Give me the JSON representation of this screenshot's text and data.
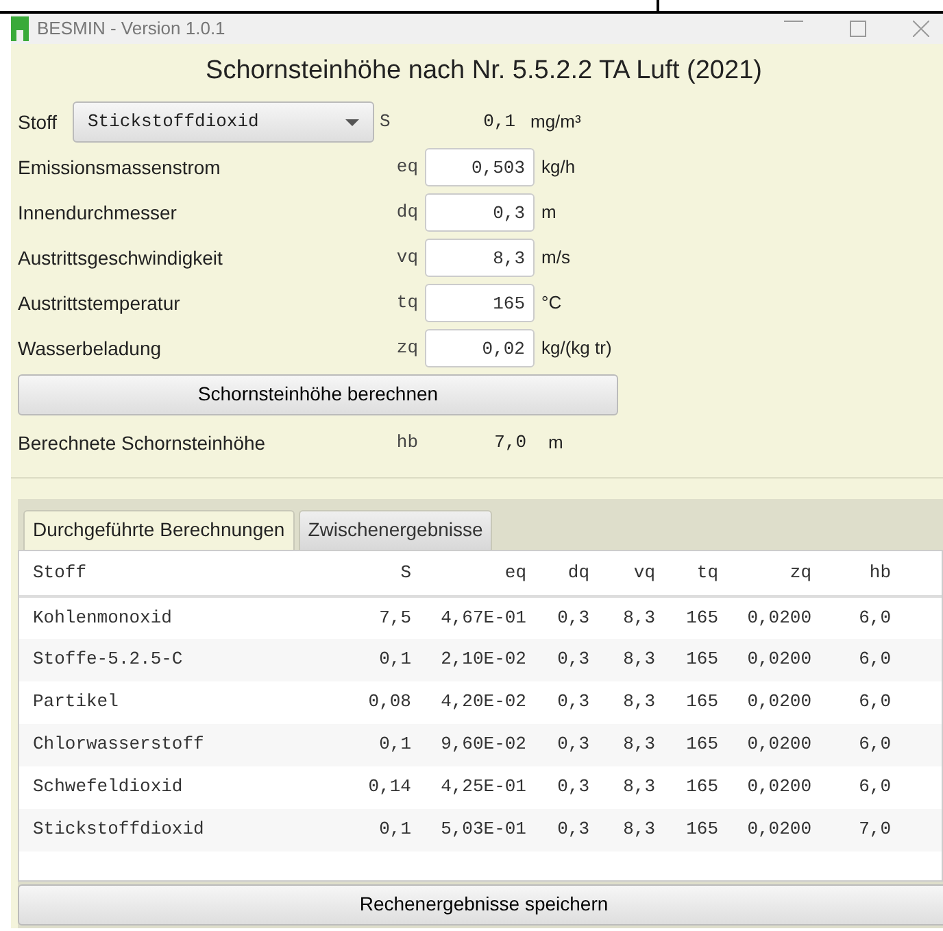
{
  "window": {
    "title": "BESMIN - Version 1.0.1"
  },
  "heading": "Schornsteinhöhe nach Nr. 5.5.2.2 TA Luft (2021)",
  "fields": [
    {
      "kind": "select",
      "label": "Stoff",
      "value": "Stickstoffdioxid",
      "symbol": "S",
      "reading": "0,1",
      "unit": "mg/m³"
    },
    {
      "kind": "input",
      "label": "Emissionsmassenstrom",
      "symbol": "eq",
      "value": "0,503",
      "unit": "kg/h"
    },
    {
      "kind": "input",
      "label": "Innendurchmesser",
      "symbol": "dq",
      "value": "0,3",
      "unit": "m"
    },
    {
      "kind": "input",
      "label": "Austrittsgeschwindigkeit",
      "symbol": "vq",
      "value": "8,3",
      "unit": "m/s"
    },
    {
      "kind": "input",
      "label": "Austrittstemperatur",
      "symbol": "tq",
      "value": "165",
      "unit": "°C"
    },
    {
      "kind": "input",
      "label": "Wasserbeladung",
      "symbol": "zq",
      "value": "0,02",
      "unit": "kg/(kg tr)"
    }
  ],
  "calculate_button": "Schornsteinhöhe berechnen",
  "result": {
    "label": "Berechnete Schornsteinhöhe",
    "symbol": "hb",
    "value": "7,0",
    "unit": "m"
  },
  "tabs": [
    {
      "label": "Durchgeführte Berechnungen",
      "selected": true
    },
    {
      "label": "Zwischenergebnisse",
      "selected": false
    }
  ],
  "table": {
    "columns": [
      "Stoff",
      "S",
      "eq",
      "dq",
      "vq",
      "tq",
      "zq",
      "hb"
    ],
    "rows": [
      [
        "Kohlenmonoxid",
        "7,5",
        "4,67E-01",
        "0,3",
        "8,3",
        "165",
        "0,0200",
        "6,0"
      ],
      [
        "Stoffe-5.2.5-C",
        "0,1",
        "2,10E-02",
        "0,3",
        "8,3",
        "165",
        "0,0200",
        "6,0"
      ],
      [
        "Partikel",
        "0,08",
        "4,20E-02",
        "0,3",
        "8,3",
        "165",
        "0,0200",
        "6,0"
      ],
      [
        "Chlorwasserstoff",
        "0,1",
        "9,60E-02",
        "0,3",
        "8,3",
        "165",
        "0,0200",
        "6,0"
      ],
      [
        "Schwefeldioxid",
        "0,14",
        "4,25E-01",
        "0,3",
        "8,3",
        "165",
        "0,0200",
        "6,0"
      ],
      [
        "Stickstoffdioxid",
        "0,1",
        "5,03E-01",
        "0,3",
        "8,3",
        "165",
        "0,0200",
        "7,0"
      ]
    ]
  },
  "save_button": "Rechenergebnisse speichern"
}
